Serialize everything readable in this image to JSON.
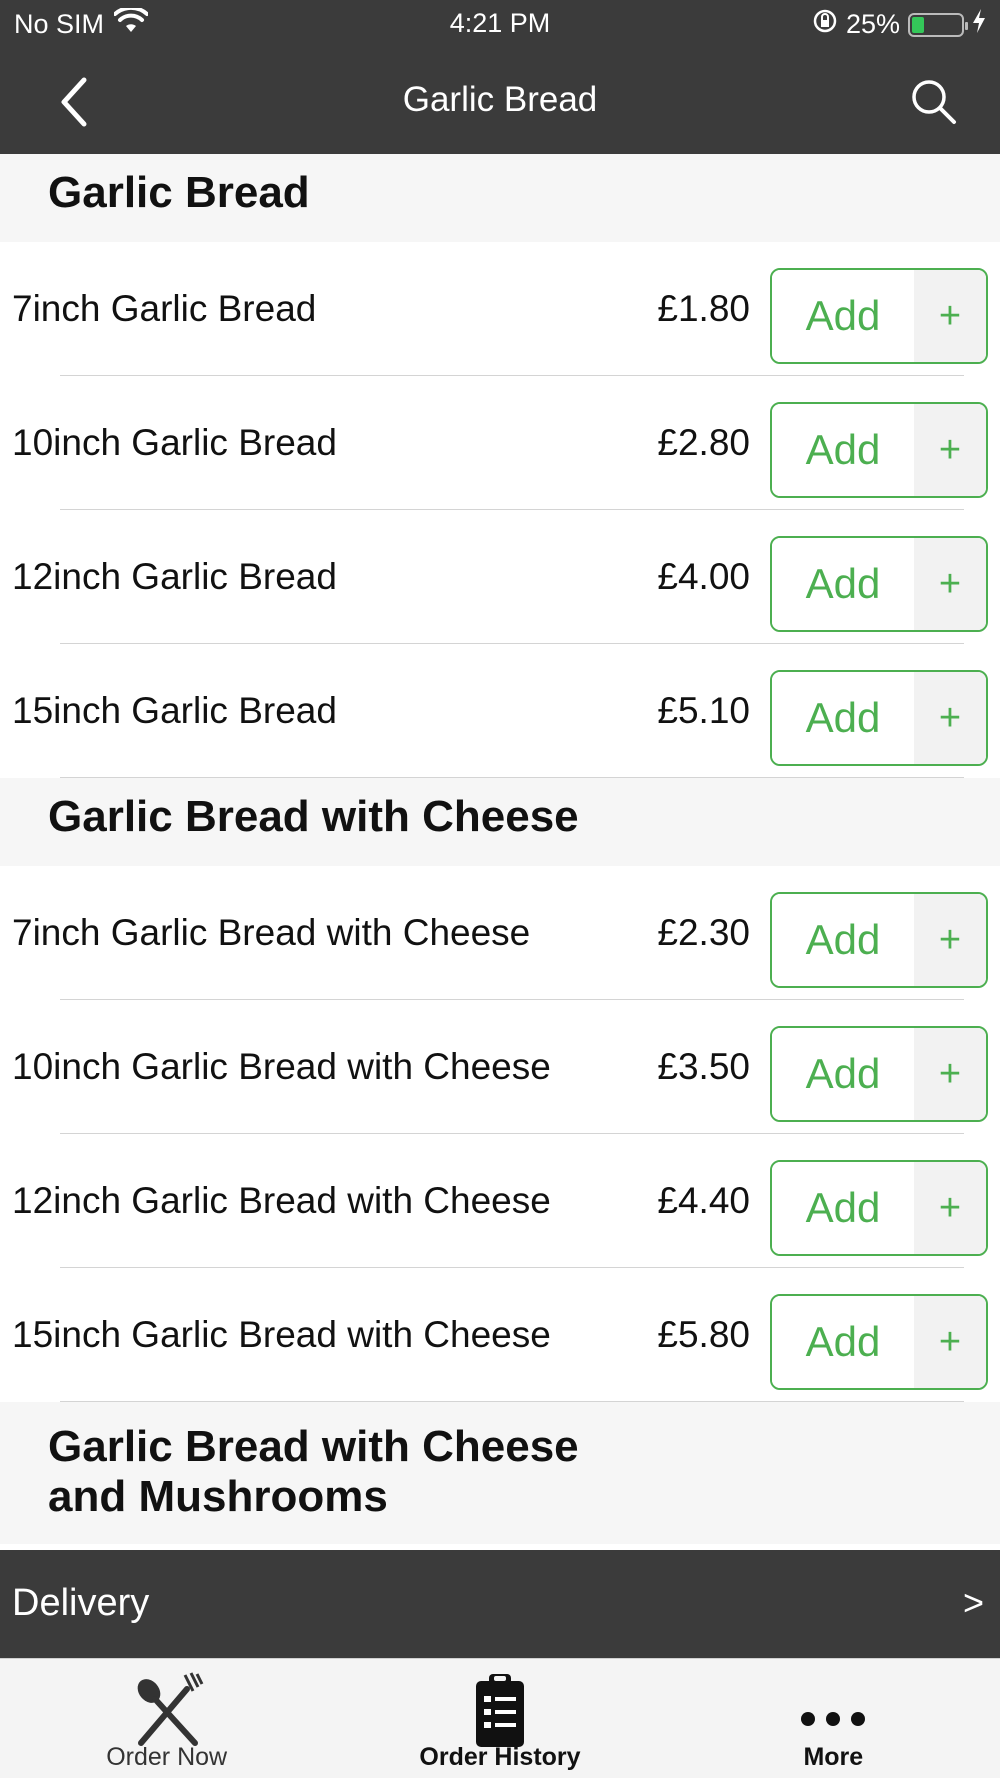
{
  "status_bar": {
    "carrier": "No SIM",
    "time": "4:21 PM",
    "battery": "25%",
    "battery_level": 0.25
  },
  "nav": {
    "title": "Garlic Bread",
    "back_icon": "chevron-left-icon",
    "search_icon": "search-icon"
  },
  "colors": {
    "accent": "#4caf50",
    "bar": "#3b3b3b",
    "section_bg": "#f6f6f6"
  },
  "sections": [
    {
      "title": "Garlic Bread",
      "items": [
        {
          "name": "7inch Garlic Bread",
          "price": "£1.80",
          "add": "Add",
          "plus": "+"
        },
        {
          "name": "10inch Garlic Bread",
          "price": "£2.80",
          "add": "Add",
          "plus": "+"
        },
        {
          "name": "12inch Garlic Bread",
          "price": "£4.00",
          "add": "Add",
          "plus": "+"
        },
        {
          "name": "15inch Garlic Bread",
          "price": "£5.10",
          "add": "Add",
          "plus": "+"
        }
      ]
    },
    {
      "title": "Garlic Bread with Cheese",
      "items": [
        {
          "name": "7inch Garlic Bread with Cheese",
          "price": "£2.30",
          "add": "Add",
          "plus": "+"
        },
        {
          "name": "10inch Garlic Bread with Cheese",
          "price": "£3.50",
          "add": "Add",
          "plus": "+"
        },
        {
          "name": "12inch Garlic Bread with Cheese",
          "price": "£4.40",
          "add": "Add",
          "plus": "+"
        },
        {
          "name": "15inch Garlic Bread with Cheese",
          "price": "£5.80",
          "add": "Add",
          "plus": "+"
        }
      ]
    },
    {
      "title_line1": "Garlic Bread with Cheese",
      "title_line2": "and Mushrooms"
    }
  ],
  "delivery": {
    "label": "Delivery",
    "chevron": ">"
  },
  "tabs": [
    {
      "label": "Order Now",
      "icon": "fork-knife-icon"
    },
    {
      "label": "Order History",
      "icon": "clipboard-list-icon"
    },
    {
      "label": "More",
      "icon": "more-dots-icon"
    }
  ]
}
